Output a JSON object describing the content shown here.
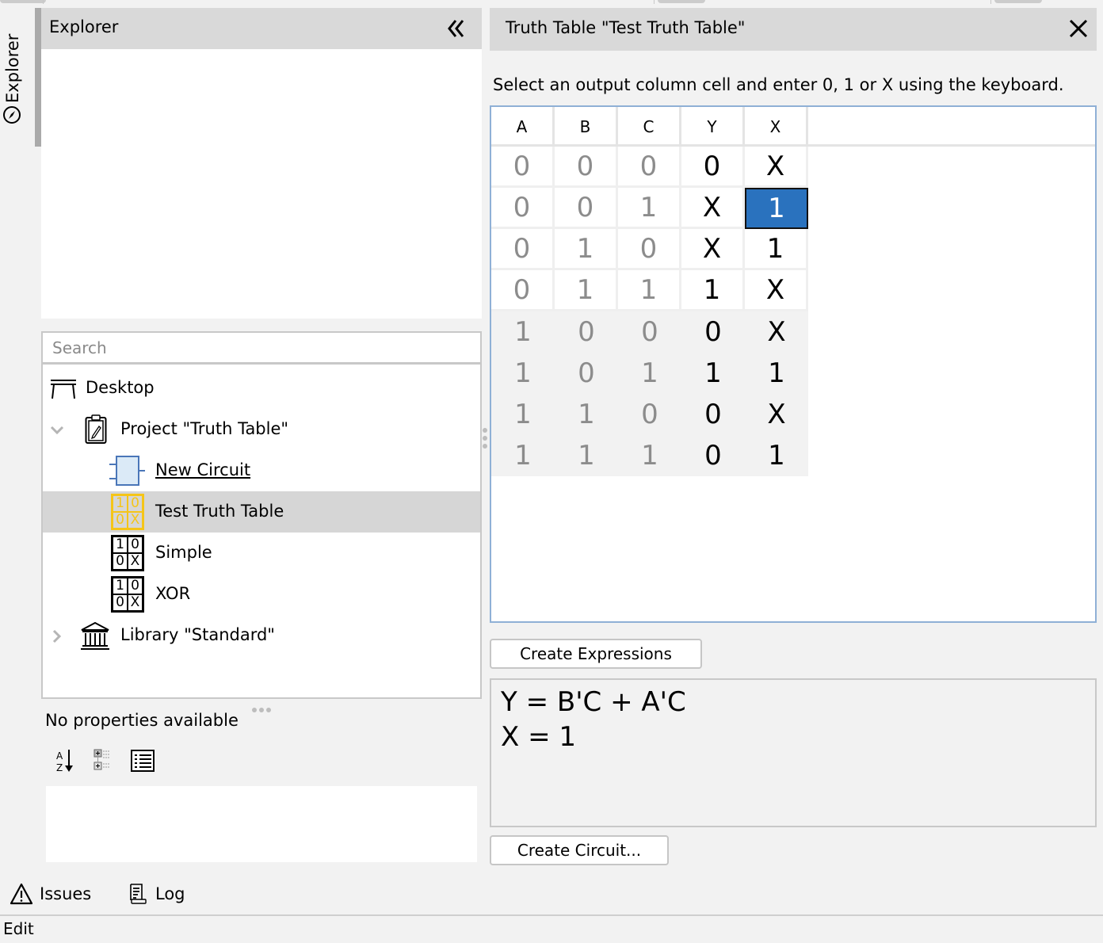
{
  "sidebar_tab": {
    "label": "Explorer",
    "icon": "compass-icon"
  },
  "explorer": {
    "title": "Explorer",
    "collapse_icon": "double-chevron-left-icon",
    "search_placeholder": "Search",
    "search_value": "",
    "tree": [
      {
        "label": "Desktop",
        "icon": "desk-icon",
        "level": 0
      },
      {
        "label": "Project \"Truth Table\"",
        "icon": "clipboard-icon",
        "level": 0,
        "expanded": true
      },
      {
        "label": "New Circuit",
        "icon": "circuit-icon",
        "level": 1,
        "link": true
      },
      {
        "label": "Test Truth Table",
        "icon": "truth-table-icon",
        "level": 1,
        "selected": true,
        "icon_glyphs": [
          "1",
          "0",
          "0",
          "X"
        ]
      },
      {
        "label": "Simple",
        "icon": "truth-table-icon",
        "level": 1,
        "icon_glyphs": [
          "1",
          "0",
          "0",
          "X"
        ]
      },
      {
        "label": "XOR",
        "icon": "truth-table-icon",
        "level": 1,
        "icon_glyphs": [
          "1",
          "0",
          "0",
          "X"
        ]
      },
      {
        "label": "Library \"Standard\"",
        "icon": "library-icon",
        "level": 0,
        "expanded": false
      }
    ]
  },
  "properties": {
    "empty_text": "No properties available",
    "toolbar": [
      "sort-alphabetical-icon",
      "categorized-icon",
      "list-view-icon"
    ]
  },
  "bottom_tabs": [
    {
      "label": "Issues",
      "icon": "warning-icon"
    },
    {
      "label": "Log",
      "icon": "log-icon"
    }
  ],
  "status_bar": {
    "text": "Edit"
  },
  "truth_table_panel": {
    "title": "Truth Table \"Test Truth Table\"",
    "close_icon": "close-icon",
    "instructions": "Select an output column cell and enter 0, 1 or X using the keyboard.",
    "columns": [
      "A",
      "B",
      "C",
      "Y",
      "X"
    ],
    "input_columns": [
      "A",
      "B",
      "C"
    ],
    "output_columns": [
      "Y",
      "X"
    ],
    "rows": [
      [
        "0",
        "0",
        "0",
        "0",
        "X"
      ],
      [
        "0",
        "0",
        "1",
        "X",
        "1"
      ],
      [
        "0",
        "1",
        "0",
        "X",
        "1"
      ],
      [
        "0",
        "1",
        "1",
        "1",
        "X"
      ],
      [
        "1",
        "0",
        "0",
        "0",
        "X"
      ],
      [
        "1",
        "0",
        "1",
        "1",
        "1"
      ],
      [
        "1",
        "1",
        "0",
        "0",
        "X"
      ],
      [
        "1",
        "1",
        "1",
        "0",
        "1"
      ]
    ],
    "selected_cell": {
      "row": 1,
      "column": "X"
    },
    "selection_color": "#2a72be",
    "create_expressions_label": "Create Expressions",
    "expressions": [
      "Y = B'C + A'C",
      "X = 1"
    ],
    "create_circuit_label": "Create Circuit..."
  }
}
